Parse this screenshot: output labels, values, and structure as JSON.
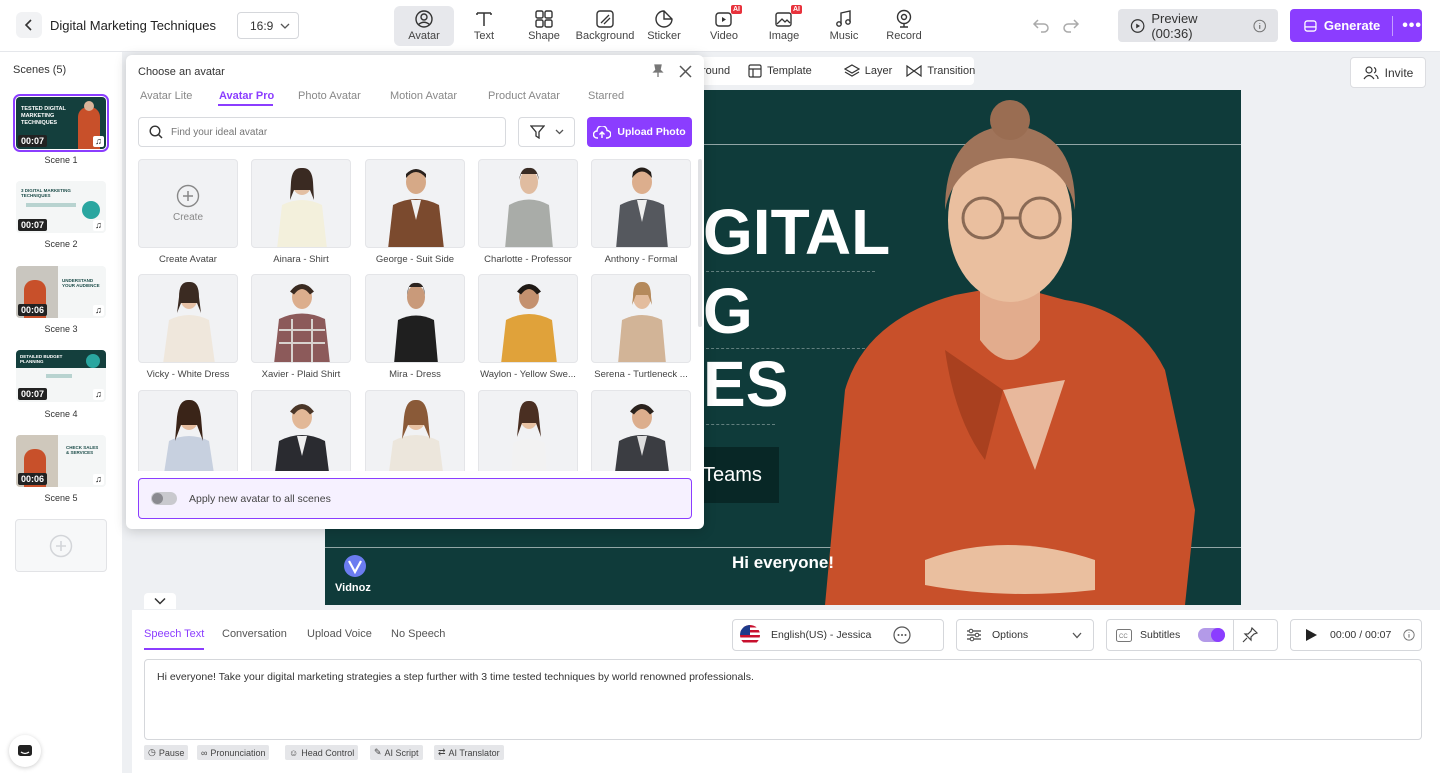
{
  "app": {
    "title": "Digital Marketing Techniques",
    "ratio": "16:9"
  },
  "toolbar": {
    "tools": [
      "Avatar",
      "Text",
      "Shape",
      "Background",
      "Sticker",
      "Video",
      "Image",
      "Music",
      "Record"
    ],
    "ai_badge": "AI",
    "preview_label": "Preview (00:36)",
    "generate_label": "Generate"
  },
  "scenes": {
    "header": "Scenes (5)",
    "items": [
      {
        "label": "Scene 1",
        "duration": "00:07",
        "title": "TESTED DIGITAL MARKETING TECHNIQUES"
      },
      {
        "label": "Scene 2",
        "duration": "00:07",
        "title": "3 DIGITAL MARKETING TECHNIQUES"
      },
      {
        "label": "Scene 3",
        "duration": "00:06",
        "title": "UNDERSTAND YOUR AUDIENCE"
      },
      {
        "label": "Scene 4",
        "duration": "00:07",
        "title": "DETAILED BUDGET PLANNING"
      },
      {
        "label": "Scene 5",
        "duration": "00:06",
        "title": "CHECK SALES & SERVICES"
      }
    ]
  },
  "subtoolbar": {
    "background_partial": "round",
    "template": "Template",
    "layer": "Layer",
    "transition": "Transition"
  },
  "invite_label": "Invite",
  "canvas": {
    "line1": "GITAL",
    "line2": "G",
    "line3": "ES",
    "button": "Teams",
    "subtitle": "Hi everyone!",
    "logo": "Vidnoz"
  },
  "popup": {
    "title": "Choose an avatar",
    "tabs": [
      "Avatar Lite",
      "Avatar Pro",
      "Photo Avatar",
      "Motion Avatar",
      "Product Avatar",
      "Starred"
    ],
    "active_tab": "Avatar Pro",
    "search_placeholder": "Find your ideal avatar",
    "upload_label": "Upload Photo",
    "create_label": "Create",
    "avatars": [
      "Create Avatar",
      "Ainara - Shirt",
      "George - Suit Side",
      "Charlotte - Professor",
      "Anthony - Formal",
      "Vicky - White Dress",
      "Xavier - Plaid Shirt",
      "Mira - Dress",
      "Waylon - Yellow Swe...",
      "Serena - Turtleneck ...",
      "",
      "",
      "",
      "",
      ""
    ],
    "apply_label": "Apply new avatar to all scenes"
  },
  "bottom": {
    "tabs": [
      "Speech Text",
      "Conversation",
      "Upload Voice",
      "No Speech"
    ],
    "voice": "English(US) - Jessica",
    "options": "Options",
    "subtitles": "Subtitles",
    "time": "00:00 / 00:07",
    "script": "Hi everyone! Take your digital marketing strategies a step further with 3 time tested techniques by world renowned professionals.",
    "chips": [
      "Pause",
      "Pronunciation",
      "Head Control",
      "AI Script",
      "AI Translator"
    ]
  },
  "colors": {
    "accent": "#8b3dff",
    "canvas_bg": "#0f3b3a",
    "shirt": "#c8502a"
  }
}
